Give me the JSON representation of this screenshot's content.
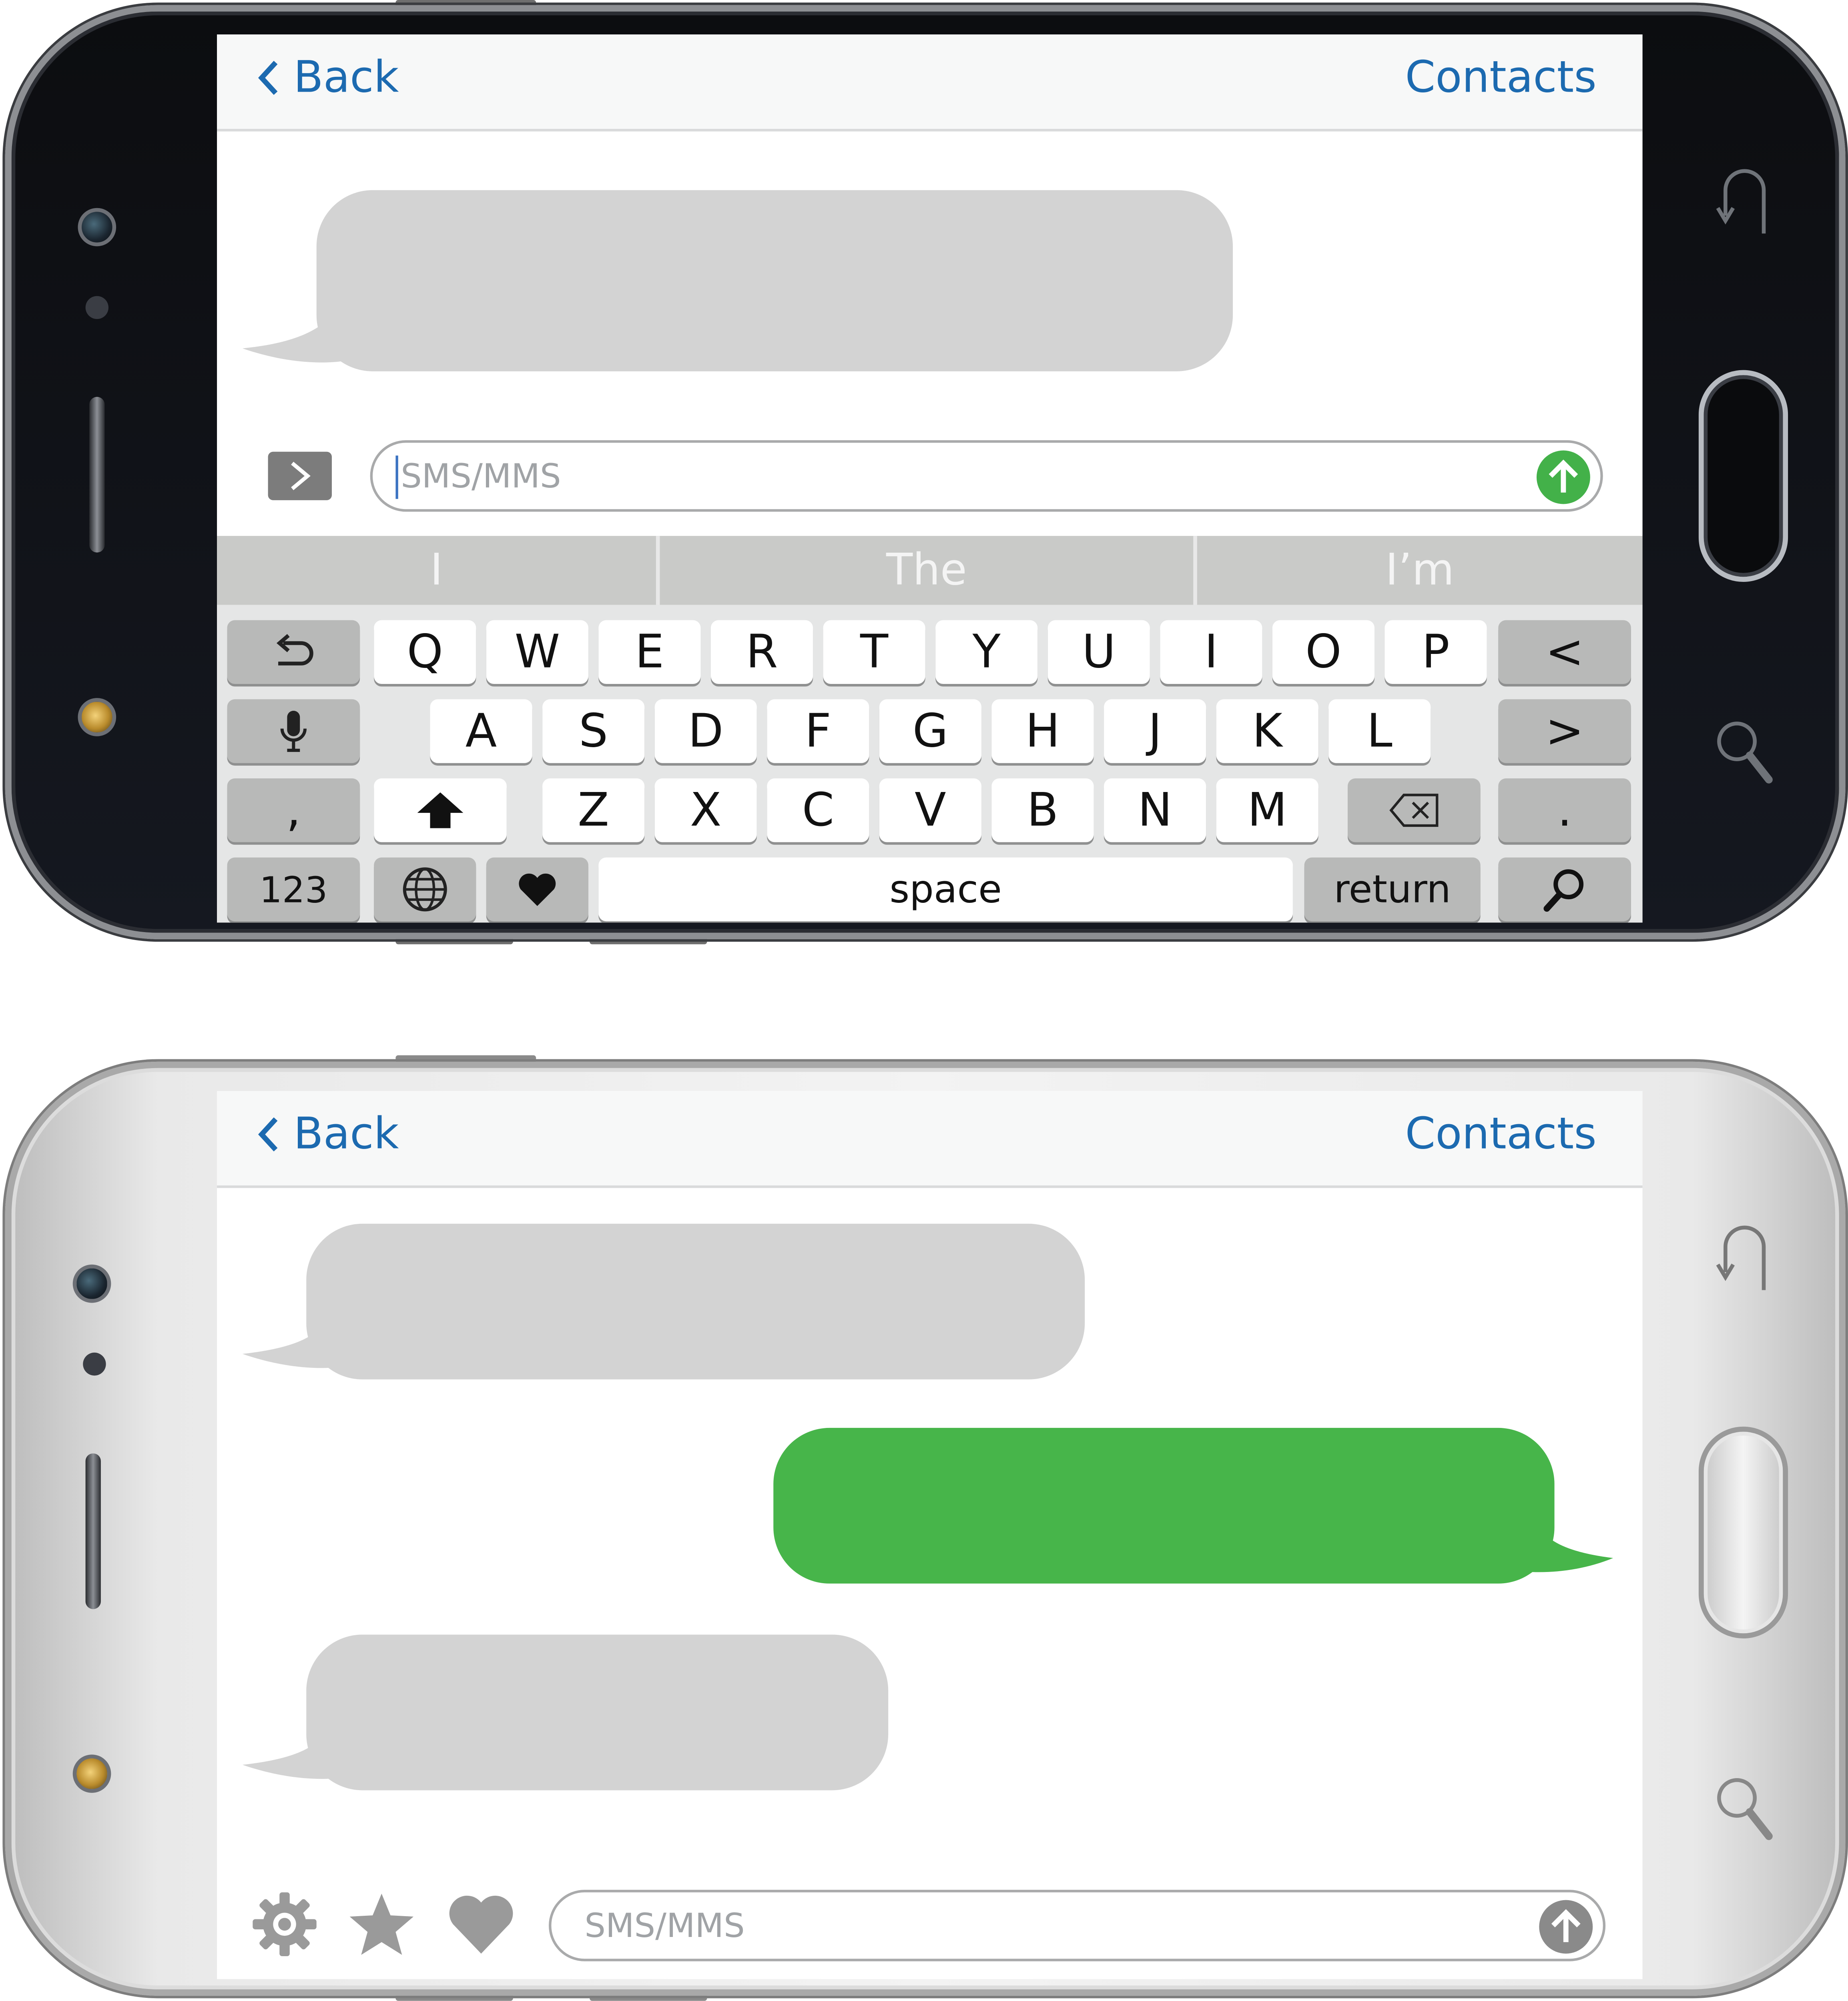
{
  "colors": {
    "link_blue": "#1c6ab0",
    "bubble_gray": "#d3d3d3",
    "bubble_green": "#47b54a",
    "send_green": "#43b149"
  },
  "phone_top": {
    "navbar": {
      "back_label": "Back",
      "contacts_label": "Contacts"
    },
    "compose": {
      "placeholder": "SMS/MMS",
      "expand_icon": "chevron-right-icon",
      "send_icon": "arrow-up-icon"
    },
    "suggestions": [
      "I",
      "The",
      "I’m"
    ],
    "keyboard": {
      "row1": [
        "Q",
        "W",
        "E",
        "R",
        "T",
        "Y",
        "U",
        "I",
        "O",
        "P"
      ],
      "row2": [
        "A",
        "S",
        "D",
        "F",
        "G",
        "H",
        "J",
        "K",
        "L"
      ],
      "row3": [
        "Z",
        "X",
        "C",
        "V",
        "B",
        "N",
        "M"
      ],
      "comma": ",",
      "period": ".",
      "left_arrow": "<",
      "right_arrow": ">",
      "numbers_label": "123",
      "space_label": "space",
      "return_label": "return"
    }
  },
  "phone_bottom": {
    "navbar": {
      "back_label": "Back",
      "contacts_label": "Contacts"
    },
    "compose": {
      "placeholder": "SMS/MMS",
      "send_icon": "arrow-up-icon"
    },
    "toolbar_icons": [
      "gear-icon",
      "star-icon",
      "heart-icon"
    ]
  }
}
